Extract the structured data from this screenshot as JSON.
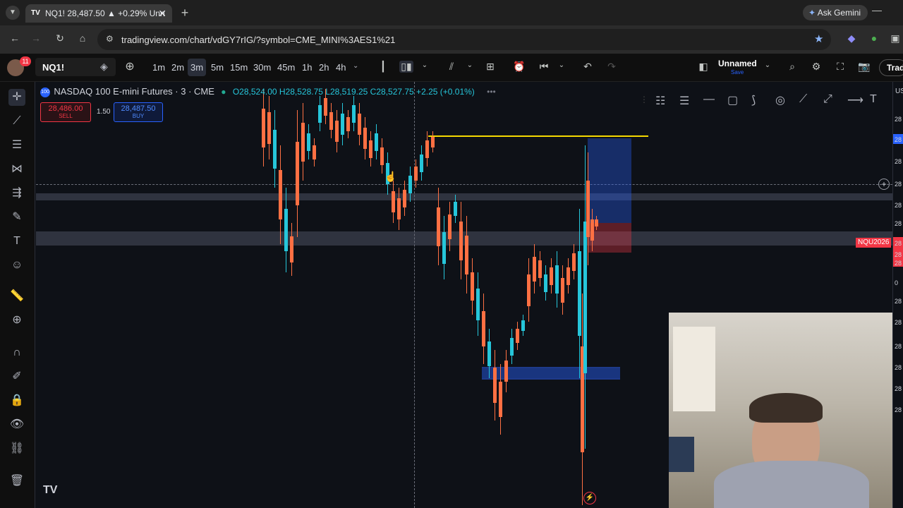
{
  "browser": {
    "tab_title": "NQ1! 28,487.50 ▲ +0.29% Unn",
    "url": "tradingview.com/chart/vdGY7rIG/?symbol=CME_MINI%3AES1%21",
    "gemini_label": "Ask Gemini"
  },
  "toolbar": {
    "symbol": "NQ1!",
    "badge": "11",
    "intervals": [
      "1m",
      "2m",
      "3m",
      "5m",
      "15m",
      "30m",
      "45m",
      "1h",
      "2h",
      "4h"
    ],
    "active_interval": "3m",
    "layout_name": "Unnamed",
    "save_label": "Save",
    "trade_label": "Trad"
  },
  "chart": {
    "title": "NASDAQ 100 E-mini Futures · 3 · CME",
    "ohlc": "O28,524.00 H28,528.75 L28,519.25 C28,527.75 +2.25 (+0.01%)",
    "sell_price": "28,486.00",
    "sell_label": "SELL",
    "spread": "1.50",
    "buy_price": "28,487.50",
    "buy_label": "BUY",
    "contract_tag": "NQU2026",
    "axis_right_header": "US",
    "logo_text": "TV",
    "colors": {
      "up": "#26c6da",
      "down": "#ff7043",
      "yellow_line": "#f5d800",
      "zone": "#3d4151"
    }
  },
  "axis_labels": [
    "28",
    "28",
    "28",
    "28",
    "28",
    "28",
    "28",
    "28",
    "28",
    "0",
    "28",
    "28",
    "28",
    "28",
    "28",
    "28"
  ]
}
